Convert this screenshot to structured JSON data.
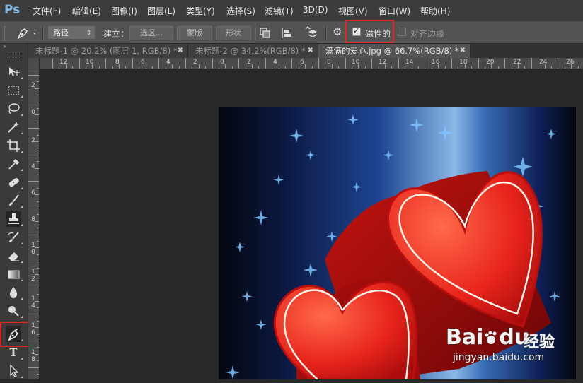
{
  "app": {
    "logo": "Ps"
  },
  "menu": [
    "文件(F)",
    "编辑(E)",
    "图像(I)",
    "图层(L)",
    "类型(Y)",
    "选择(S)",
    "滤镜(T)",
    "3D(D)",
    "视图(V)",
    "窗口(W)",
    "帮助(H)"
  ],
  "options": {
    "mode_value": "路径",
    "build_label": "建立：",
    "selection_button": "选区...",
    "mask_button": "蒙版",
    "shape_button": "形状",
    "magnetic_label": "磁性的",
    "magnetic_checked": true,
    "align_edges_label": "对齐边缘",
    "align_edges_checked": false
  },
  "tabs": [
    {
      "label": "未标题-1 @ 20.2% (图层 1, RGB/8) *",
      "active": false
    },
    {
      "label": "未标题-2 @ 34.2%(RGB/8) *",
      "active": false
    },
    {
      "label": "满满的爱心.jpg @ 66.7%(RGB/8) *",
      "active": true
    }
  ],
  "ruler_h": [
    "12",
    "10",
    "8",
    "6",
    "4",
    "2",
    "0",
    "2",
    "4",
    "6",
    "8",
    "10",
    "12",
    "14",
    "16",
    "18",
    "20",
    "22",
    "24",
    "26"
  ],
  "ruler_v": [
    "2",
    "0",
    "2",
    "4",
    "6",
    "8",
    "10",
    "12",
    "14",
    "16",
    "18"
  ],
  "tools": [
    "move-icon",
    "marquee-icon",
    "lasso-icon",
    "magic-wand-icon",
    "crop-icon",
    "eyedropper-icon",
    "healing-brush-icon",
    "brush-icon",
    "clone-stamp-icon",
    "history-brush-icon",
    "eraser-icon",
    "gradient-icon",
    "blur-icon",
    "dodge-icon",
    "pen-icon",
    "type-icon",
    "path-selection-icon"
  ],
  "watermark": {
    "main": "Bai",
    "paw": "du",
    "cn": "经验",
    "url": "jingyan.baidu.com"
  },
  "colors": {
    "highlight": "#e0242a",
    "heart": "#e0221e",
    "bg_blue": "#1d3a7a"
  }
}
